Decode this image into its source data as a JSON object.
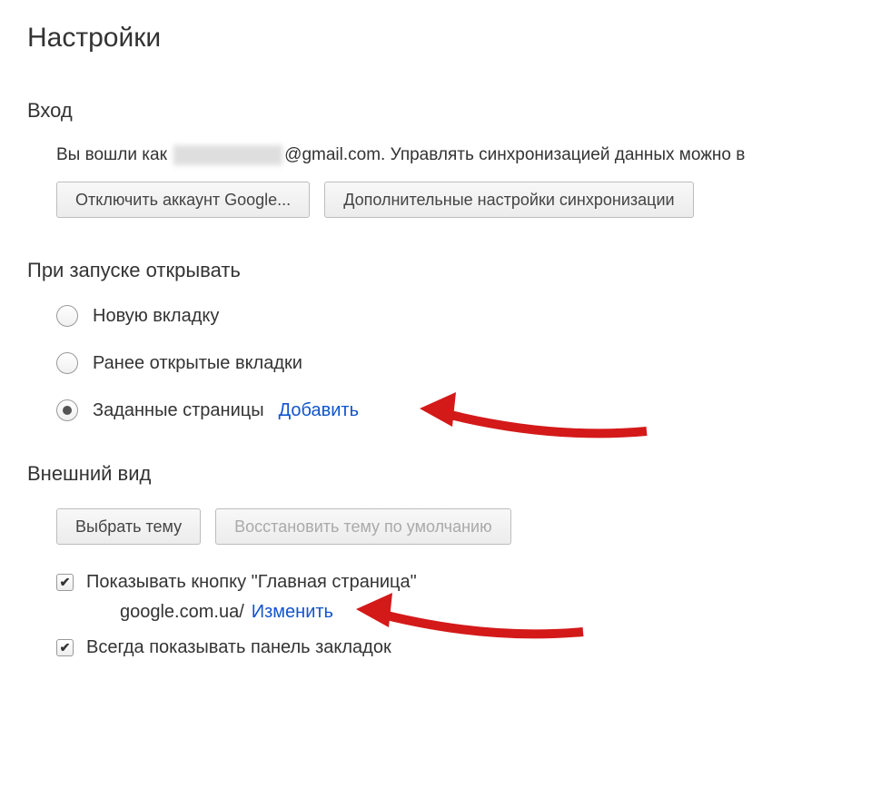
{
  "page": {
    "title": "Настройки"
  },
  "signin": {
    "title": "Вход",
    "text_prefix": "Вы вошли как ",
    "email_domain": "@gmail.com.",
    "text_suffix": " Управлять синхронизацией данных можно в",
    "disconnect_button": "Отключить аккаунт Google...",
    "advanced_sync_button": "Дополнительные настройки синхронизации"
  },
  "startup": {
    "title": "При запуске открывать",
    "options": [
      {
        "label": "Новую вкладку",
        "checked": false
      },
      {
        "label": "Ранее открытые вкладки",
        "checked": false
      },
      {
        "label": "Заданные страницы",
        "checked": true
      }
    ],
    "add_link": "Добавить"
  },
  "appearance": {
    "title": "Внешний вид",
    "choose_theme_button": "Выбрать тему",
    "reset_theme_button": "Восстановить тему по умолчанию",
    "show_home_checkbox": "Показывать кнопку \"Главная страница\"",
    "home_url": "google.com.ua/",
    "change_link": "Изменить",
    "show_bookmarks_checkbox": "Всегда показывать панель закладок"
  }
}
